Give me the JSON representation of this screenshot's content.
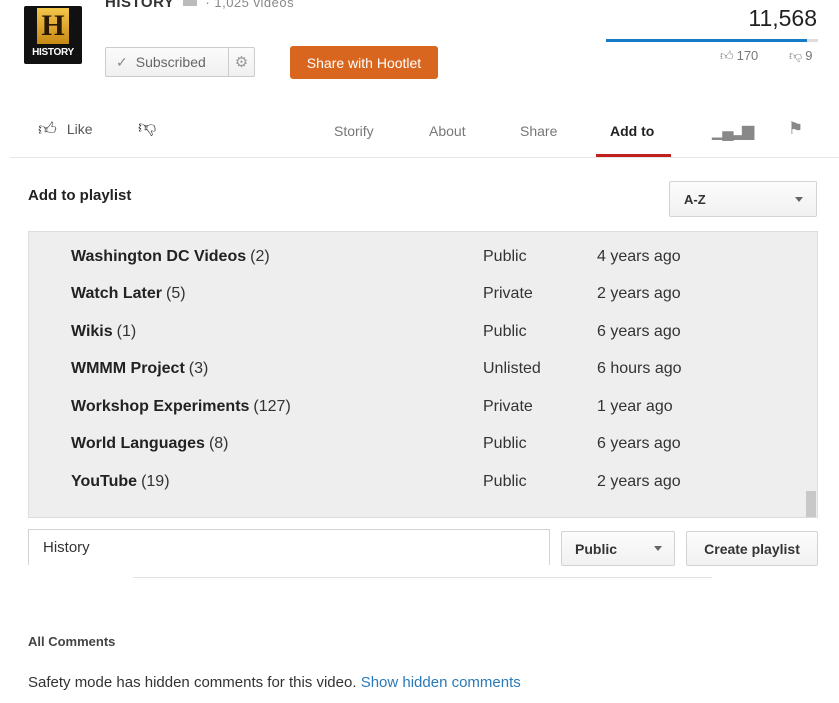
{
  "channel": {
    "logo_letter": "H",
    "logo_text": "HISTORY",
    "name": "HISTORY",
    "video_count": "· 1,025 videos",
    "subscribe_label": "Subscribed",
    "hootlet_label": "Share with Hootlet"
  },
  "stats": {
    "views": "11,568",
    "like_ratio": 0.95,
    "likes": "170",
    "dislikes": "9"
  },
  "actions": {
    "like_label": "Like",
    "tabs": [
      {
        "label": "Storify"
      },
      {
        "label": "About"
      },
      {
        "label": "Share"
      },
      {
        "label": "Add to",
        "active": true
      }
    ]
  },
  "playlist_panel": {
    "title": "Add to playlist",
    "sort_value": "A-Z",
    "items": [
      {
        "name": "Washington DC Videos",
        "count": "(2)",
        "privacy": "Public",
        "age": "4 years ago"
      },
      {
        "name": "Watch Later",
        "count": "(5)",
        "privacy": "Private",
        "age": "2 years ago"
      },
      {
        "name": "Wikis",
        "count": "(1)",
        "privacy": "Public",
        "age": "6 years ago"
      },
      {
        "name": "WMMM Project",
        "count": "(3)",
        "privacy": "Unlisted",
        "age": "6 hours ago"
      },
      {
        "name": "Workshop Experiments",
        "count": "(127)",
        "privacy": "Private",
        "age": "1 year ago"
      },
      {
        "name": "World Languages",
        "count": "(8)",
        "privacy": "Public",
        "age": "6 years ago"
      },
      {
        "name": "YouTube",
        "count": "(19)",
        "privacy": "Public",
        "age": "2 years ago"
      }
    ],
    "new_playlist_value": "History",
    "new_playlist_privacy": "Public",
    "create_label": "Create playlist"
  },
  "comments": {
    "title": "All Comments",
    "safety_text": "Safety mode has hidden comments for this video.",
    "show_hidden_label": "Show hidden comments"
  },
  "colors": {
    "hootlet": "#d9661e",
    "view_bar": "#167ac6",
    "active_tab": "#c1201f",
    "link": "#2a7ab8"
  }
}
